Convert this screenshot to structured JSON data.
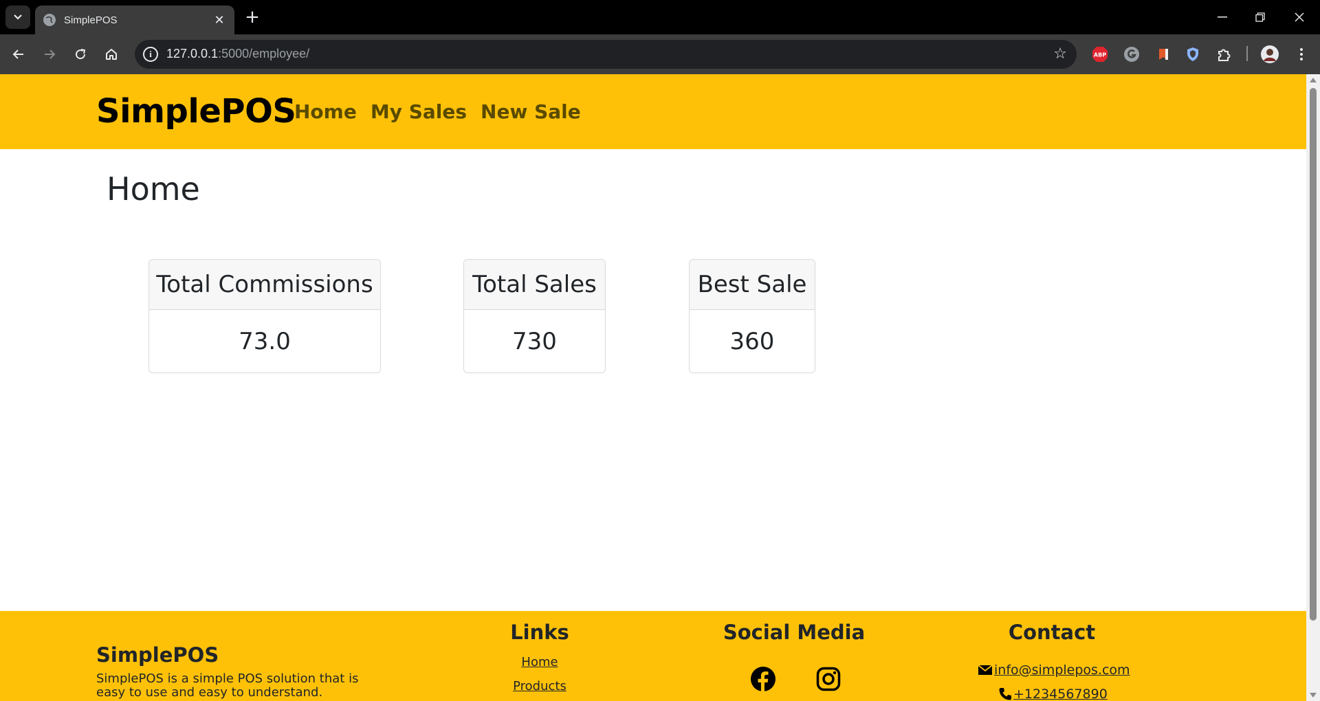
{
  "browser": {
    "tab_title": "SimplePOS",
    "tab_close_glyph": "✕",
    "new_tab_glyph": "+",
    "url_host": "127.0.0.1",
    "url_rest": ":5000/employee/",
    "extensions": [
      "adblock-plus-icon",
      "grammarly-icon",
      "bookmark-extension-icon",
      "shield-extension-icon",
      "puzzle-extensions-icon",
      "profile-avatar"
    ],
    "ext_abp_label": "ABP"
  },
  "header": {
    "brand": "SimplePOS",
    "nav": [
      "Home",
      "My Sales",
      "New Sale"
    ],
    "bg_color": "#ffc107"
  },
  "main": {
    "title": "Home",
    "cards": [
      {
        "label": "Total Commissions",
        "value": "73.0"
      },
      {
        "label": "Total Sales",
        "value": "730"
      },
      {
        "label": "Best Sale",
        "value": "360"
      }
    ]
  },
  "footer": {
    "brand": "SimplePOS",
    "description": "SimplePOS is a simple POS solution that is easy to use and easy to understand.",
    "links_title": "Links",
    "links": [
      "Home",
      "Products"
    ],
    "social_title": "Social Media",
    "social_icons": [
      "facebook-icon",
      "instagram-icon"
    ],
    "contact_title": "Contact",
    "email": " info@simplepos.com",
    "phone": " +1234567890"
  }
}
